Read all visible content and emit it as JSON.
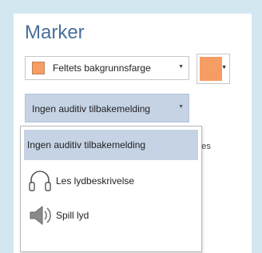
{
  "title": "Marker",
  "background_dropdown": {
    "label": "Feltets bakgrunnsfarge",
    "swatch_color": "#f59d63"
  },
  "color_button": {
    "color": "#f59d63"
  },
  "audio_dropdown": {
    "selected": "Ingen auditiv tilbakemelding"
  },
  "partially_hidden_text": "veres",
  "menu": {
    "items": [
      {
        "label": "Ingen auditiv tilbakemelding",
        "icon": "none",
        "selected": true
      },
      {
        "label": "Les lydbeskrivelse",
        "icon": "headphones-icon",
        "selected": false
      },
      {
        "label": "Spill lyd",
        "icon": "speaker-icon",
        "selected": false
      }
    ]
  }
}
